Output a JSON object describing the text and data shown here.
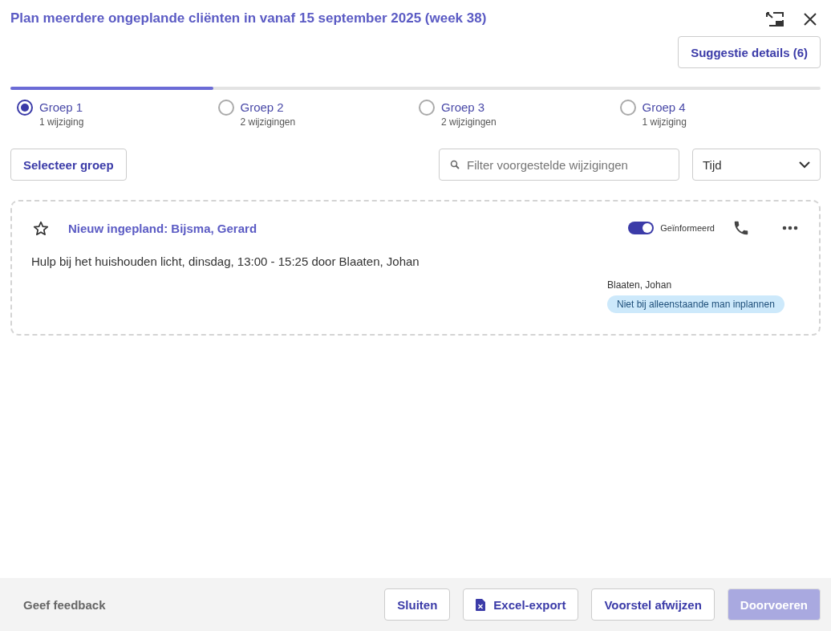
{
  "dialog": {
    "title": "Plan meerdere ongeplande cliënten in vanaf 15 september 2025 (week 38)",
    "details_button": "Suggestie details (6)"
  },
  "progress": {
    "level": 0.25
  },
  "groups": [
    {
      "label": "Groep 1",
      "count": "1 wijziging",
      "selected": true
    },
    {
      "label": "Groep 2",
      "count": "2 wijzigingen",
      "selected": false
    },
    {
      "label": "Groep 3",
      "count": "2 wijzigingen",
      "selected": false
    },
    {
      "label": "Groep 4",
      "count": "1 wijziging",
      "selected": false
    }
  ],
  "toolbar": {
    "select_button": "Selecteer groep",
    "filter": {
      "placeholder": "Filter voorgestelde wijzigingen"
    },
    "sort": {
      "value": "Tijd"
    }
  },
  "changes": [
    {
      "title": "Nieuw ingepland: Bijsma, Gerard",
      "starred": false,
      "informed": {
        "label": "Geïnformeerd",
        "on": true
      },
      "description": "Hulp bij het huishouden licht, dinsdag, 13:00 - 15:25 door Blaaten, Johan",
      "employee": "Blaaten, Johan",
      "tag": "Niet bij alleenstaande man inplannen"
    }
  ],
  "footer": {
    "feedback": "Geef feedback",
    "buttons": [
      {
        "label": "Sluiten",
        "kind": "plain",
        "disabled": false
      },
      {
        "label": "Excel-export",
        "kind": "excel",
        "disabled": false
      },
      {
        "label": "Voorstel afwijzen",
        "kind": "plain",
        "disabled": false
      },
      {
        "label": "Doorvoeren",
        "kind": "primary",
        "disabled": true
      }
    ]
  }
}
